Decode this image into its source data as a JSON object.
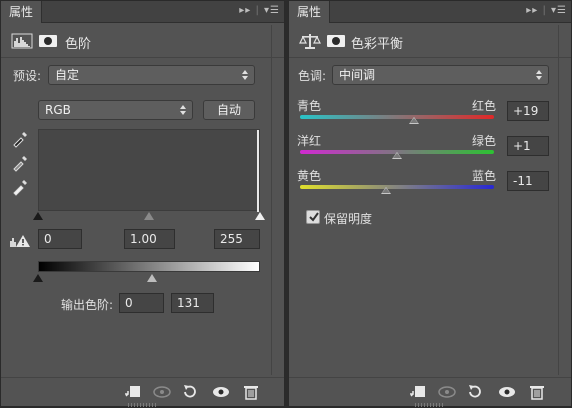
{
  "levels": {
    "tab": "属性",
    "title": "色阶",
    "preset_label": "预设:",
    "preset_value": "自定",
    "channel_value": "RGB",
    "auto_label": "自动",
    "input_black": "0",
    "input_gamma": "1.00",
    "input_white": "255",
    "output_label": "输出色阶:",
    "output_black": "0",
    "output_white": "131",
    "output_gray_position": 0.514
  },
  "color_balance": {
    "tab": "属性",
    "title": "色彩平衡",
    "tone_label": "色调:",
    "tone_value": "中间调",
    "sliders": [
      {
        "left": "青色",
        "right": "红色",
        "value": "+19",
        "grad": [
          "#29c4c8",
          "#e02828"
        ]
      },
      {
        "left": "洋红",
        "right": "绿色",
        "value": "+1",
        "grad": [
          "#d12ad1",
          "#2cc232"
        ]
      },
      {
        "left": "黄色",
        "right": "蓝色",
        "value": "-11",
        "grad": [
          "#e0e02c",
          "#2828d4"
        ]
      }
    ],
    "preserve_label": "保留明度",
    "preserve_checked": true
  },
  "icons": [
    "histogram-icon",
    "mask-icon",
    "balance-icon",
    "eyedropper-icon",
    "clip-warning-icon",
    "clip-to-layer-icon",
    "view-previous-icon",
    "reset-icon",
    "visibility-eye-icon",
    "trash-icon",
    "collapse-icon",
    "panel-menu-icon"
  ]
}
